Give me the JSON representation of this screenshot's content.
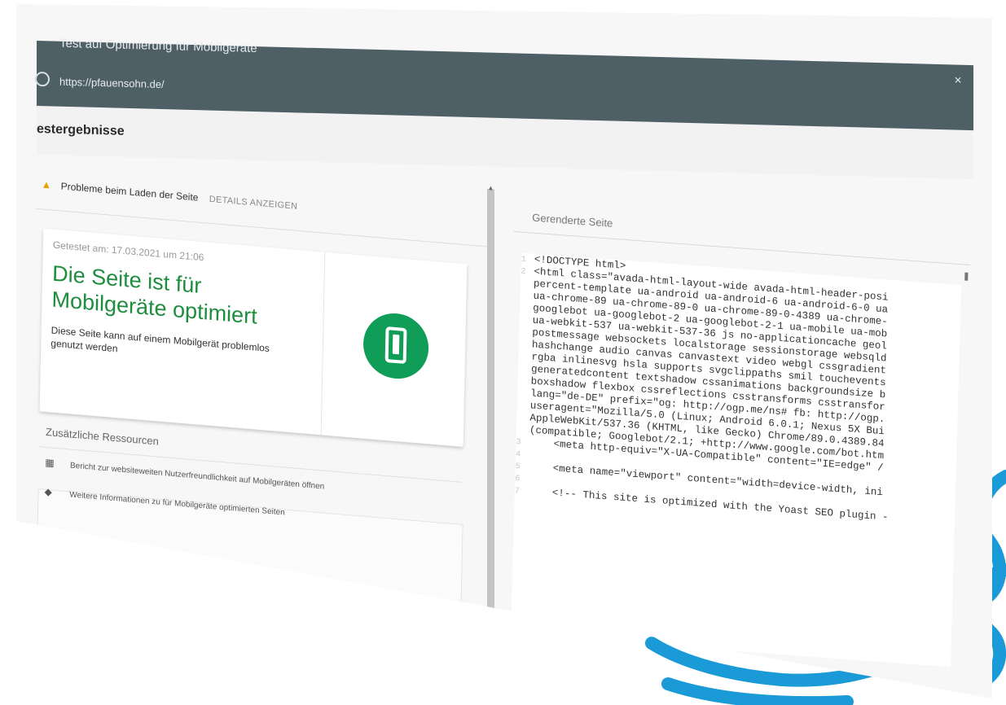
{
  "window": {
    "title": "Test auf Optimierung für Mobilgeräte",
    "url": "https://pfauensohn.de/",
    "section_heading": "estergebnisse"
  },
  "warning": {
    "text": "Probleme beim Laden der Seite",
    "details_label": "DETAILS ANZEIGEN"
  },
  "result": {
    "tested_at": "Getestet am: 17.03.2021 um 21:06",
    "title": "Die Seite ist für Mobilgeräte optimiert",
    "subtitle": "Diese Seite kann auf einem Mobilgerät problemlos genutzt werden"
  },
  "resources": {
    "title": "Zusätzliche Ressourcen",
    "items": [
      {
        "icon": "report-icon",
        "label": "Bericht zur websiteweiten Nutzerfreundlichkeit auf Mobilgeräten öffnen"
      },
      {
        "icon": "school-icon",
        "label": "Weitere Informationen zu für Mobilgeräte optimierten Seiten"
      }
    ]
  },
  "rendered": {
    "title": "Gerenderte Seite",
    "lines": [
      {
        "n": "1",
        "text": "<!DOCTYPE html>"
      },
      {
        "n": "2",
        "text": "<html class=\"avada-html-layout-wide avada-html-header-posi"
      },
      {
        "n": "",
        "text": "percent-template ua-android ua-android-6 ua-android-6-0 ua"
      },
      {
        "n": "",
        "text": "ua-chrome-89 ua-chrome-89-0 ua-chrome-89-0-4389 ua-chrome-"
      },
      {
        "n": "",
        "text": "googlebot ua-googlebot-2 ua-googlebot-2-1 ua-mobile ua-mob"
      },
      {
        "n": "",
        "text": "ua-webkit-537 ua-webkit-537-36 js no-applicationcache geol"
      },
      {
        "n": "",
        "text": "postmessage websockets localstorage sessionstorage websqld"
      },
      {
        "n": "",
        "text": "hashchange audio canvas canvastext video webgl cssgradient"
      },
      {
        "n": "",
        "text": "rgba inlinesvg hsla supports svgclippaths smil touchevents"
      },
      {
        "n": "",
        "text": "generatedcontent textshadow cssanimations backgroundsize b"
      },
      {
        "n": "",
        "text": "boxshadow flexbox cssreflections csstransforms csstransfor"
      },
      {
        "n": "",
        "text": "lang=\"de-DE\" prefix=\"og: http://ogp.me/ns# fb: http://ogp."
      },
      {
        "n": "",
        "text": "useragent=\"Mozilla/5.0 (Linux; Android 6.0.1; Nexus 5X Bui"
      },
      {
        "n": "",
        "text": "AppleWebKit/537.36 (KHTML, like Gecko) Chrome/89.0.4389.84"
      },
      {
        "n": "",
        "text": "(compatible; Googlebot/2.1; +http://www.google.com/bot.htm"
      },
      {
        "n": "3",
        "text": "    <meta http-equiv=\"X-UA-Compatible\" content=\"IE=edge\" /"
      },
      {
        "n": "4",
        "text": ""
      },
      {
        "n": "5",
        "text": "    <meta name=\"viewport\" content=\"width=device-width, ini"
      },
      {
        "n": "6",
        "text": ""
      },
      {
        "n": "7",
        "text": "    <!-- This site is optimized with the Yoast SEO plugin -"
      }
    ]
  },
  "colors": {
    "header_bg": "#4e5f66",
    "success_green": "#1e8e3e",
    "icon_green": "#109d58",
    "brand_swirl": "#1a9ad6"
  }
}
